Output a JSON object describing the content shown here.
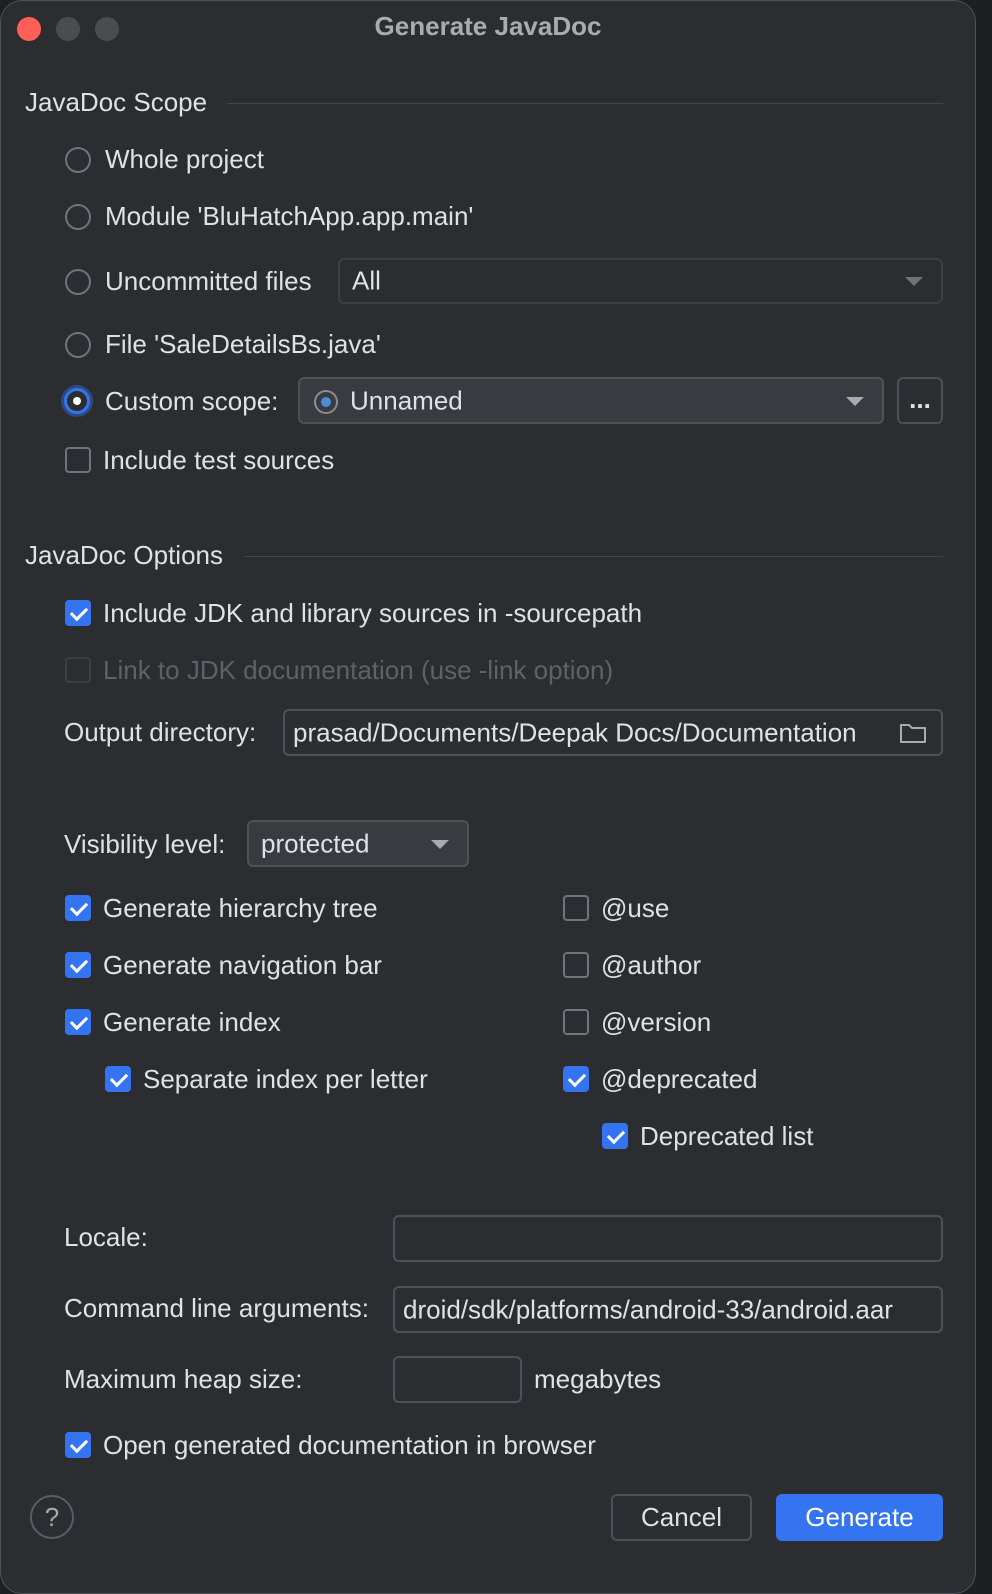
{
  "window": {
    "title": "Generate JavaDoc"
  },
  "scope": {
    "heading": "JavaDoc Scope",
    "whole_project": "Whole project",
    "module": "Module 'BluHatchApp.app.main'",
    "uncommitted": "Uncommitted files",
    "uncommitted_select": "All",
    "file": "File 'SaleDetailsBs.java'",
    "custom": "Custom scope:",
    "custom_select": "Unnamed",
    "browse_label": "...",
    "include_tests": "Include test sources"
  },
  "options": {
    "heading": "JavaDoc Options",
    "include_jdk": "Include JDK and library sources in -sourcepath",
    "link_jdk": "Link to JDK documentation (use -link option)",
    "output_label": "Output directory:",
    "output_value": "prasad/Documents/Deepak Docs/Documentation",
    "visibility_label": "Visibility level:",
    "visibility_value": "protected",
    "hierarchy": "Generate hierarchy tree",
    "navbar": "Generate navigation bar",
    "index": "Generate index",
    "separate_index": "Separate index per letter",
    "use": "@use",
    "author": "@author",
    "version": "@version",
    "deprecated": "@deprecated",
    "deprecated_list": "Deprecated list",
    "locale_label": "Locale:",
    "locale_value": "",
    "cmd_label": "Command line arguments:",
    "cmd_value": "droid/sdk/platforms/android-33/android.aar",
    "heap_label": "Maximum heap size:",
    "heap_value": "",
    "heap_unit": "megabytes",
    "open_browser": "Open generated documentation in browser"
  },
  "footer": {
    "help": "?",
    "cancel": "Cancel",
    "generate": "Generate"
  },
  "colors": {
    "accent": "#3574f0",
    "close": "#ff5f57",
    "background": "#2b2d30"
  }
}
